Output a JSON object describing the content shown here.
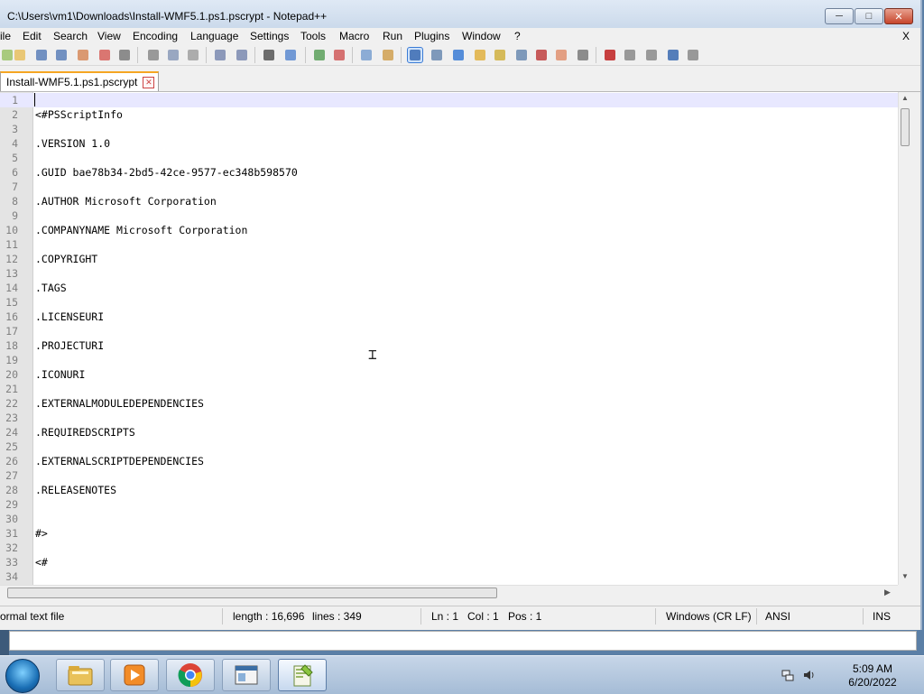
{
  "window": {
    "title": "C:\\Users\\vm1\\Downloads\\Install-WMF5.1.ps1.pscrypt - Notepad++",
    "close_x": "X"
  },
  "menu": [
    "ile",
    "Edit",
    "Search",
    "View",
    "Encoding",
    "Language",
    "Settings",
    "Tools",
    "Macro",
    "Run",
    "Plugins",
    "Window",
    "?"
  ],
  "toolbar": {
    "icons": [
      "new-file-icon",
      "open-file-icon",
      "save-icon",
      "save-all-icon",
      "close-icon",
      "close-all-icon",
      "print-icon",
      "cut-icon",
      "copy-icon",
      "paste-icon",
      "undo-icon",
      "redo-icon",
      "find-icon",
      "replace-icon",
      "zoom-in-icon",
      "zoom-out-icon",
      "sync-vertical-icon",
      "sync-horizontal-icon",
      "word-wrap-icon",
      "show-all-chars-icon",
      "indent-guide-icon",
      "document-map-icon",
      "function-list-icon",
      "folder-as-workspace-icon",
      "monitoring-icon",
      "panel-icon",
      "eye-icon",
      "record-macro-icon",
      "stop-macro-icon",
      "play-macro-icon",
      "run-macro-multiple-icon",
      "save-macro-icon"
    ]
  },
  "tab": {
    "label": "Install-WMF5.1.ps1.pscrypt"
  },
  "editor": {
    "lines": [
      {
        "n": "1",
        "text": ""
      },
      {
        "n": "2",
        "text": "<#PSScriptInfo"
      },
      {
        "n": "3",
        "text": ""
      },
      {
        "n": "4",
        "text": ".VERSION 1.0"
      },
      {
        "n": "5",
        "text": ""
      },
      {
        "n": "6",
        "text": ".GUID bae78b34-2bd5-42ce-9577-ec348b598570"
      },
      {
        "n": "7",
        "text": ""
      },
      {
        "n": "8",
        "text": ".AUTHOR Microsoft Corporation"
      },
      {
        "n": "9",
        "text": ""
      },
      {
        "n": "10",
        "text": ".COMPANYNAME Microsoft Corporation"
      },
      {
        "n": "11",
        "text": ""
      },
      {
        "n": "12",
        "text": ".COPYRIGHT"
      },
      {
        "n": "13",
        "text": ""
      },
      {
        "n": "14",
        "text": ".TAGS"
      },
      {
        "n": "15",
        "text": ""
      },
      {
        "n": "16",
        "text": ".LICENSEURI"
      },
      {
        "n": "17",
        "text": ""
      },
      {
        "n": "18",
        "text": ".PROJECTURI"
      },
      {
        "n": "19",
        "text": ""
      },
      {
        "n": "20",
        "text": ".ICONURI"
      },
      {
        "n": "21",
        "text": ""
      },
      {
        "n": "22",
        "text": ".EXTERNALMODULEDEPENDENCIES"
      },
      {
        "n": "23",
        "text": ""
      },
      {
        "n": "24",
        "text": ".REQUIREDSCRIPTS"
      },
      {
        "n": "25",
        "text": ""
      },
      {
        "n": "26",
        "text": ".EXTERNALSCRIPTDEPENDENCIES"
      },
      {
        "n": "27",
        "text": ""
      },
      {
        "n": "28",
        "text": ".RELEASENOTES"
      },
      {
        "n": "29",
        "text": ""
      },
      {
        "n": "30",
        "text": ""
      },
      {
        "n": "31",
        "text": "#>"
      },
      {
        "n": "32",
        "text": ""
      },
      {
        "n": "33",
        "text": "<#"
      },
      {
        "n": "34",
        "text": ""
      }
    ]
  },
  "status": {
    "file_type": "ormal text file",
    "length": "length : 16,696",
    "lines": "lines : 349",
    "ln": "Ln : 1",
    "col": "Col : 1",
    "pos": "Pos : 1",
    "eol": "Windows (CR LF)",
    "encoding": "ANSI",
    "mode": "INS"
  },
  "taskbar": {
    "time": "5:09 AM",
    "date": "6/20/2022",
    "apps": [
      "explorer-icon",
      "media-player-icon",
      "chrome-icon",
      "window-app-icon",
      "notepadpp-icon"
    ]
  }
}
